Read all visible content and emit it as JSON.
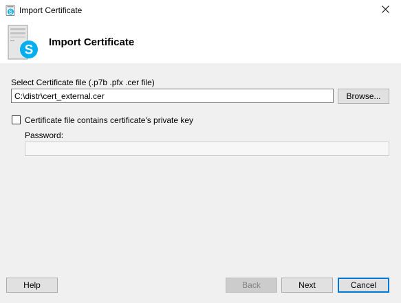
{
  "window": {
    "title": "Import Certificate",
    "close_icon": "close-icon",
    "app_icon": "skype-certificate-icon"
  },
  "header": {
    "title": "Import Certificate",
    "icon": "server-skype-icon"
  },
  "form": {
    "file_label": "Select Certificate file (.p7b .pfx .cer file)",
    "file_value": "C:\\distr\\cert_external.cer",
    "browse_label": "Browse...",
    "private_key_label": "Certificate file contains certificate's private key",
    "private_key_checked": false,
    "password_label": "Password:",
    "password_value": ""
  },
  "footer": {
    "help_label": "Help",
    "back_label": "Back",
    "next_label": "Next",
    "cancel_label": "Cancel"
  },
  "colors": {
    "skype_blue": "#00aff0",
    "focus_blue": "#0078d7"
  }
}
